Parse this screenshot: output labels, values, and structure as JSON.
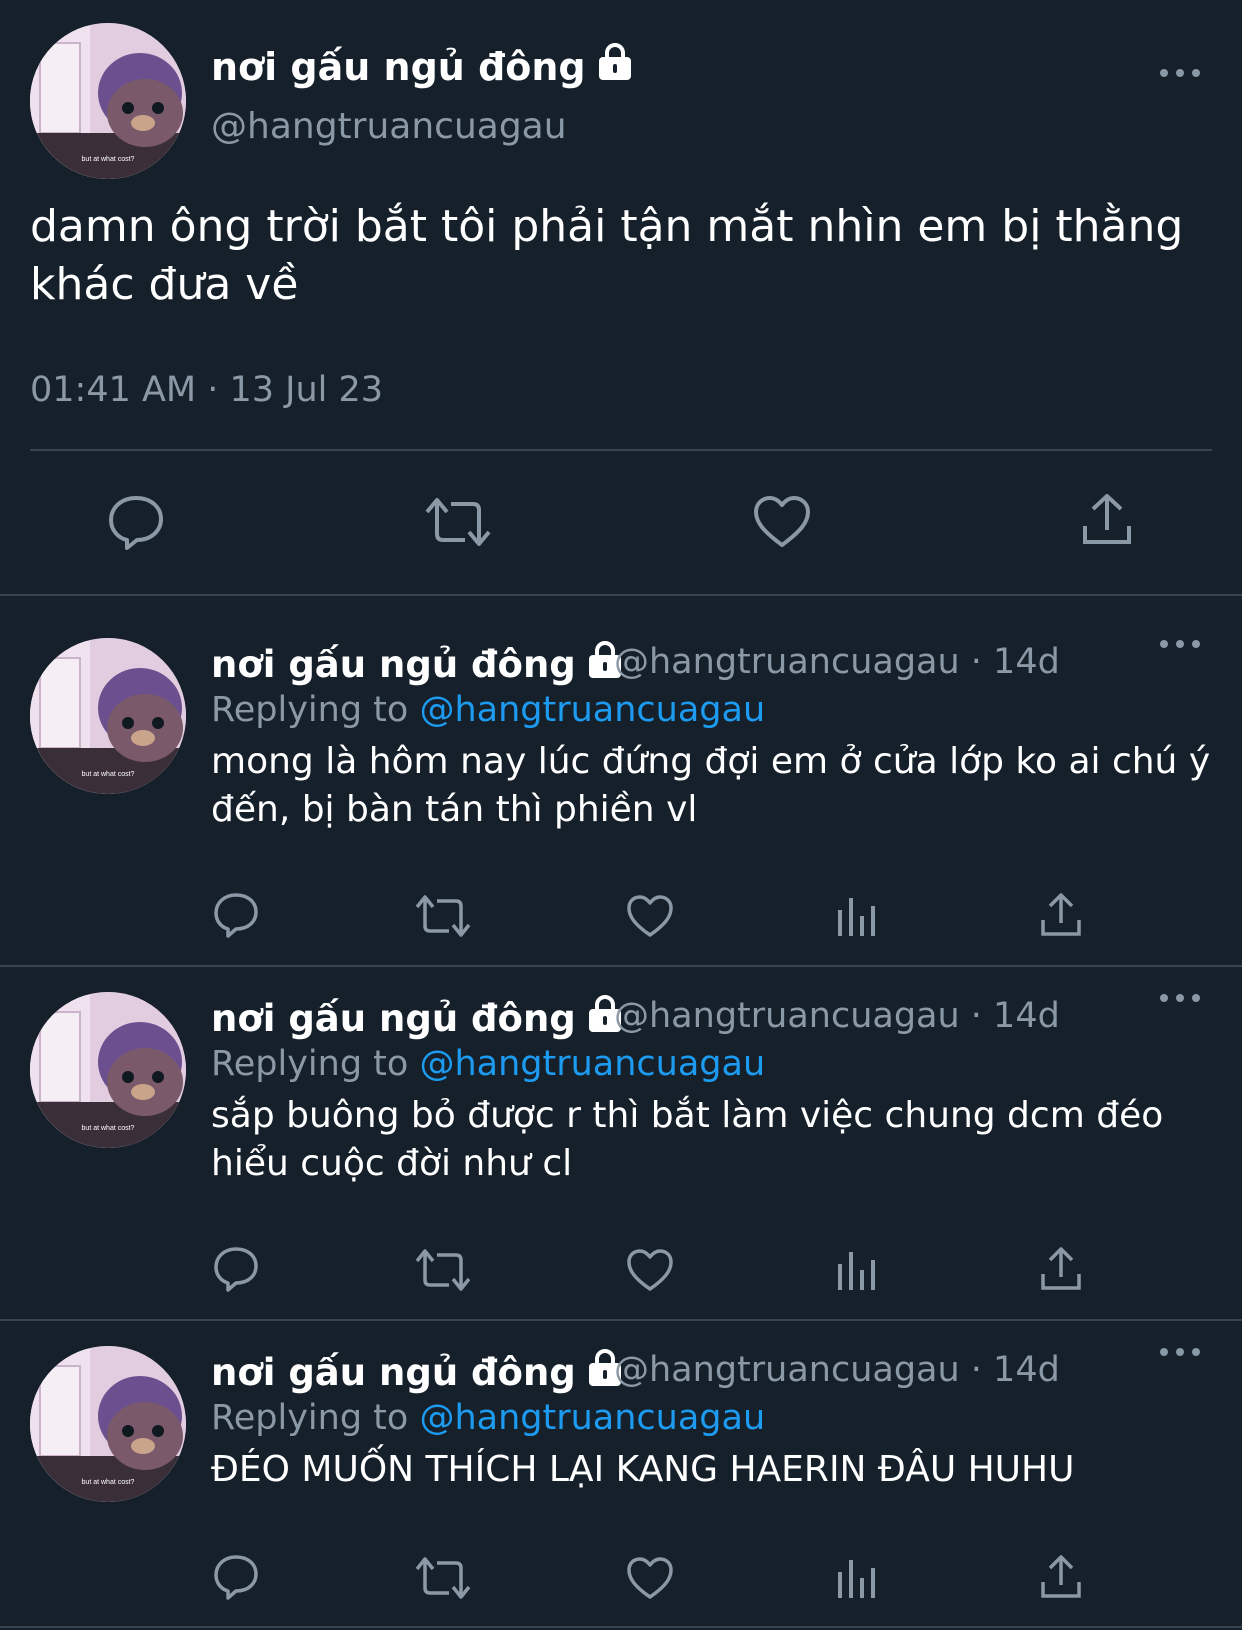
{
  "main_tweet": {
    "display_name": "nơi gấu ngủ đông",
    "handle": "@hangtruancuagau",
    "text": "damn ông trời bắt tôi phải tận mắt nhìn em bị thằng khác đưa về",
    "timestamp": "01:41 AM · 13 Jul 23",
    "avatar_caption": "but at what cost?",
    "actions": [
      "reply-icon",
      "retweet-icon",
      "like-icon",
      "share-icon"
    ]
  },
  "replies": [
    {
      "display_name": "nơi gấu ngủ đông",
      "handle_time": "@hangtruancuagau · 14d",
      "replying_prefix": "Replying to ",
      "replying_to": "@hangtruancuagau",
      "text": "mong là hôm nay lúc đứng đợi em ở cửa lớp ko ai chú ý đến, bị bàn tán thì phiền vl",
      "avatar_caption": "but at what cost?"
    },
    {
      "display_name": "nơi gấu ngủ đông",
      "handle_time": "@hangtruancuagau · 14d",
      "replying_prefix": "Replying to ",
      "replying_to": "@hangtruancuagau",
      "text": "sắp buông bỏ được r thì bắt làm việc chung dcm đéo hiểu cuộc đời như cl",
      "avatar_caption": "but at what cost?"
    },
    {
      "display_name": "nơi gấu ngủ đông",
      "handle_time": "@hangtruancuagau · 14d",
      "replying_prefix": "Replying to ",
      "replying_to": "@hangtruancuagau",
      "text": "ĐÉO MUỐN THÍCH LẠI KANG HAERIN ĐÂU HUHU",
      "avatar_caption": "but at what cost?"
    }
  ],
  "colors": {
    "background": "#15202b",
    "text": "#ffffff",
    "secondary": "#8b98a5",
    "link": "#1d9bf0",
    "divider": "#38444d"
  }
}
